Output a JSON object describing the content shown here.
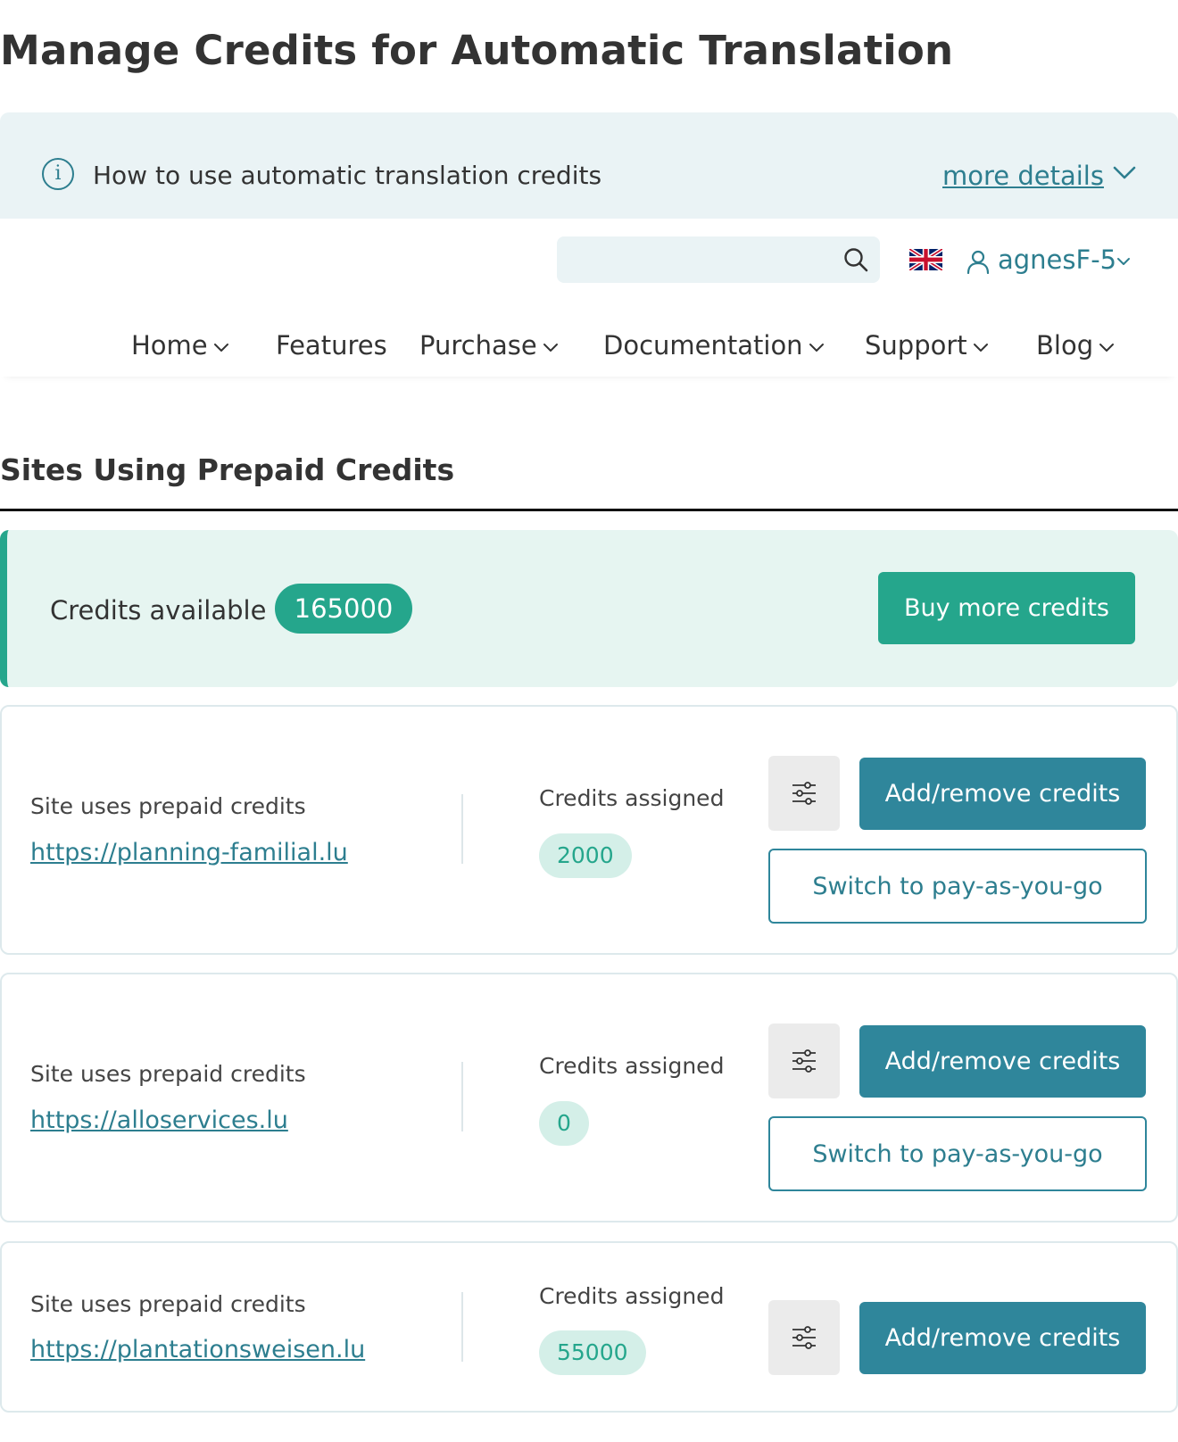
{
  "page": {
    "title": "Manage Credits for Automatic Translation"
  },
  "info_banner": {
    "text": "How to use automatic translation credits",
    "more_details": "more details",
    "icon": "info-icon"
  },
  "header": {
    "search": {
      "value": "",
      "placeholder": ""
    },
    "language_icon": "uk-flag-icon",
    "user_name": "agnesF-5"
  },
  "nav": {
    "items": [
      {
        "label": "Home",
        "has_dropdown": true
      },
      {
        "label": "Features",
        "has_dropdown": false
      },
      {
        "label": "Purchase",
        "has_dropdown": true
      },
      {
        "label": "Documentation",
        "has_dropdown": true
      },
      {
        "label": "Support",
        "has_dropdown": true
      },
      {
        "label": "Blog",
        "has_dropdown": true
      }
    ]
  },
  "section": {
    "title": "Sites Using Prepaid Credits"
  },
  "credits": {
    "label": "Credits available",
    "value": "165000",
    "buy_label": "Buy more credits"
  },
  "sites": [
    {
      "label": "Site uses prepaid credits",
      "url": "https://planning-familial.lu",
      "assigned_label": "Credits assigned",
      "assigned_value": "2000",
      "add_remove_label": "Add/remove credits",
      "switch_label": "Switch to pay-as-you-go"
    },
    {
      "label": "Site uses prepaid credits",
      "url": "https://alloservices.lu",
      "assigned_label": "Credits assigned",
      "assigned_value": "0",
      "add_remove_label": "Add/remove credits",
      "switch_label": "Switch to pay-as-you-go"
    },
    {
      "label": "Site uses prepaid credits",
      "url": "https://plantationsweisen.lu",
      "assigned_label": "Credits assigned",
      "assigned_value": "55000",
      "add_remove_label": "Add/remove credits"
    }
  ],
  "colors": {
    "accent_teal": "#2d7e8f",
    "button_teal": "#2f869b",
    "green": "#25a68c",
    "banner_bg": "#eaf3f5",
    "credits_bg": "#e6f5f1"
  }
}
